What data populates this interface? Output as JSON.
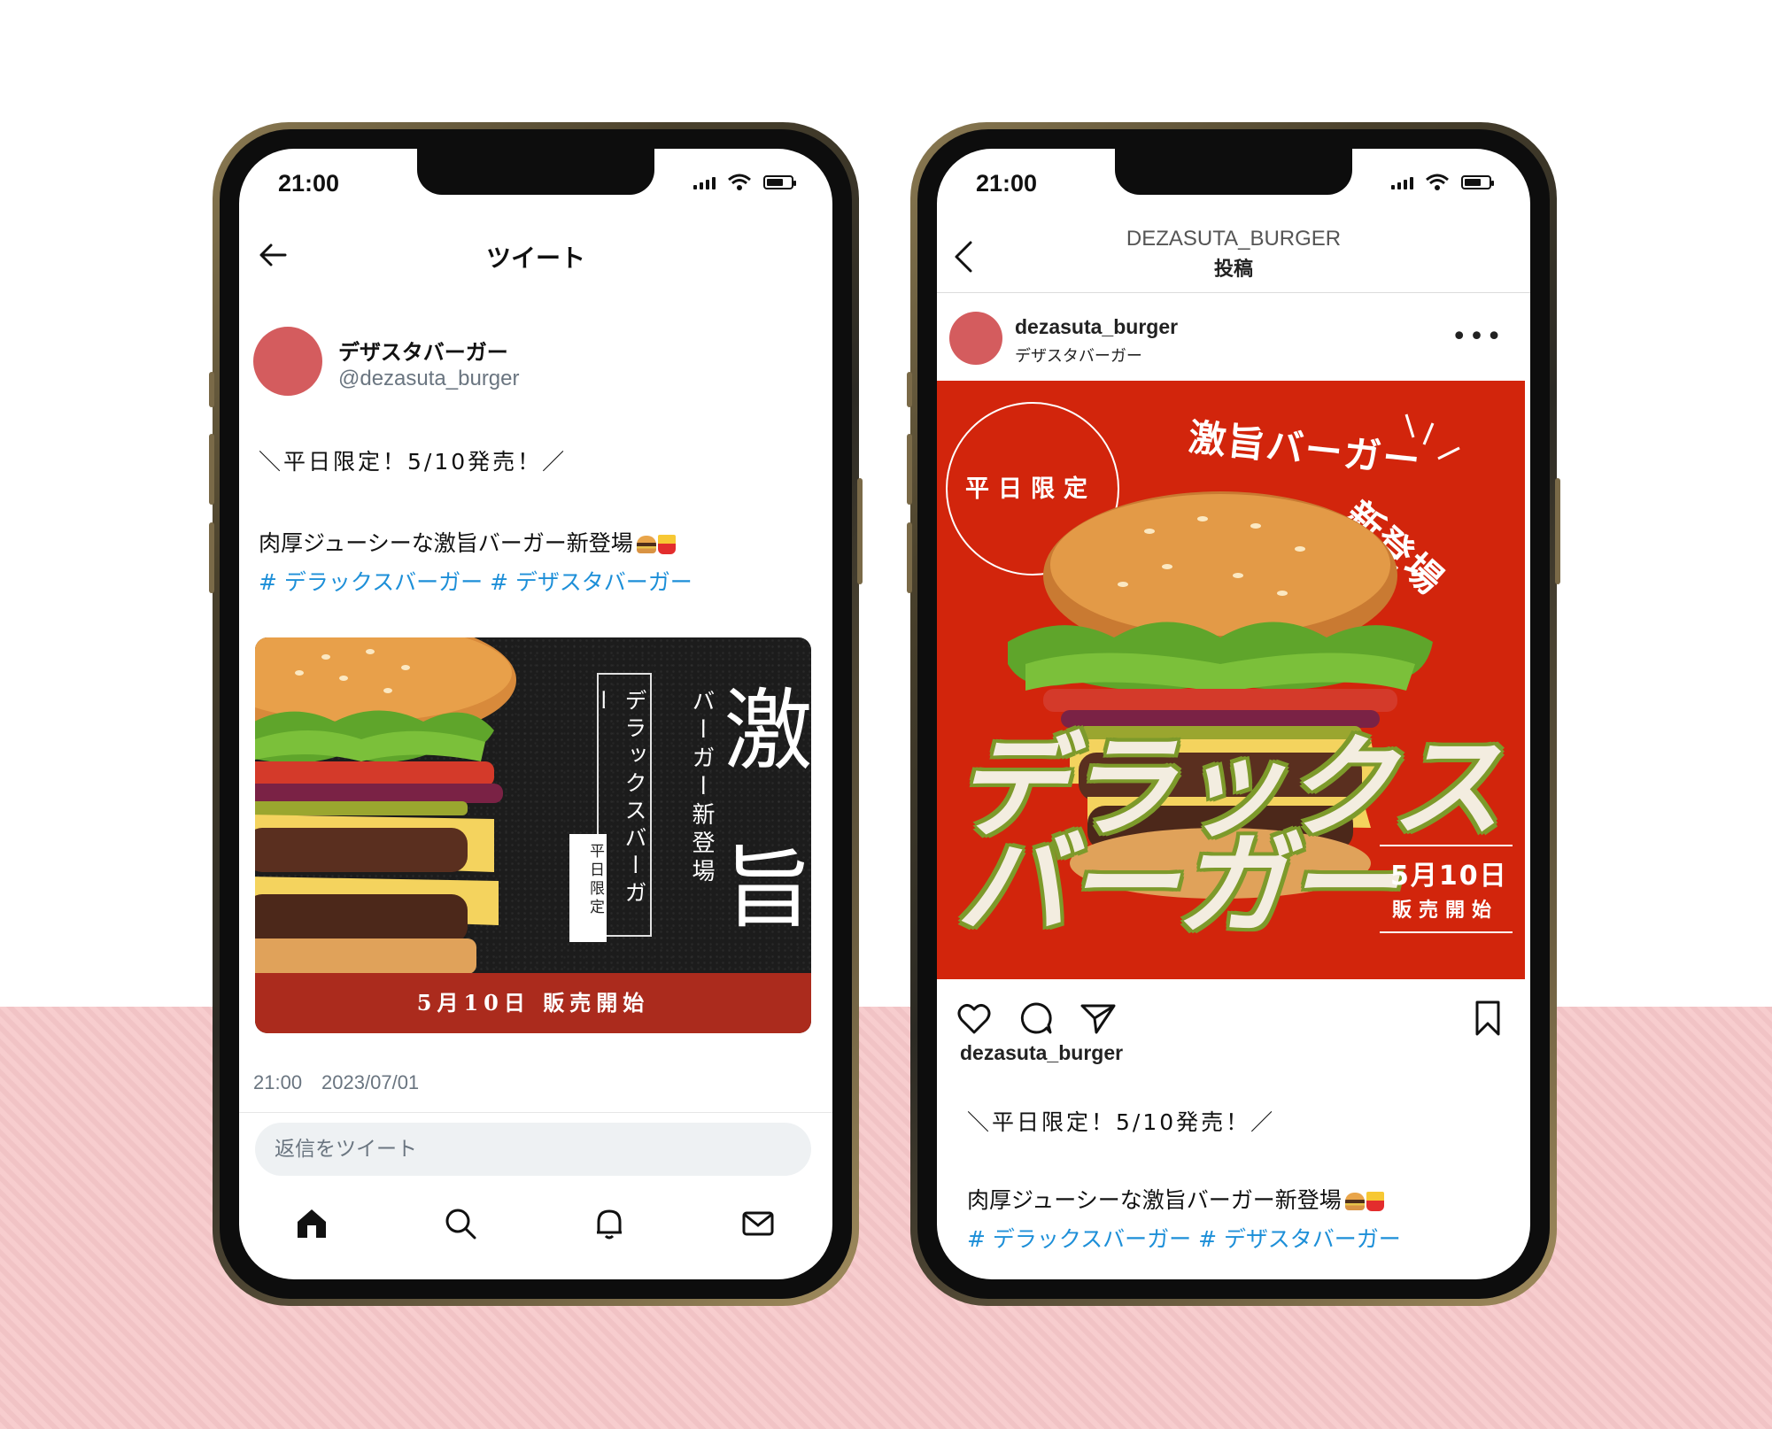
{
  "left_phone": {
    "status_time": "21:00",
    "header_title": "ツイート",
    "display_name": "デザスタバーガー",
    "handle": "@dezasuta_burger",
    "post_line1": "＼平日限定！5/10発売！／",
    "post_line2": "肉厚ジューシーな激旨バーガー新登場",
    "hashtags": "# デラックスバーガー # デザスタバーガー",
    "image": {
      "big_char1": "激",
      "big_char2": "旨",
      "col_text": "バーガー新登場",
      "boxed_text": "デラックスバーガー",
      "badge_text": "平日限定",
      "banner_text": "5月10日 販売開始"
    },
    "meta": "21:00　2023/07/01",
    "reply_placeholder": "返信をツイート"
  },
  "right_phone": {
    "status_time": "21:00",
    "account_title": "DEZASUTA_BURGER",
    "header_subtitle": "投稿",
    "username": "dezasuta_burger",
    "display_name": "デザスタバーガー",
    "more_label": "•••",
    "image": {
      "circle_text": "平日限定",
      "headline_a": "激旨バーガー",
      "headline_b": "新登場",
      "title_line1": "デラックス",
      "title_line2": "バーガー",
      "date_text": "5月10日",
      "sale_text": "販売開始"
    },
    "caption_user": "dezasuta_burger",
    "post_line1": "＼平日限定！5/10発売！／",
    "post_line2": "肉厚ジューシーな激旨バーガー新登場",
    "hashtags": "# デラックスバーガー # デザスタバーガー"
  },
  "colors": {
    "avatar": "#d45c5e",
    "hashtag": "#1d8fd8",
    "ig_red": "#d2250c",
    "banner_red": "#ab2b1d",
    "title_outline": "#7d9a2b"
  },
  "icons": [
    "back-arrow-icon",
    "home-icon",
    "search-icon",
    "bell-icon",
    "mail-icon",
    "heart-icon",
    "comment-icon",
    "send-icon",
    "bookmark-icon"
  ]
}
